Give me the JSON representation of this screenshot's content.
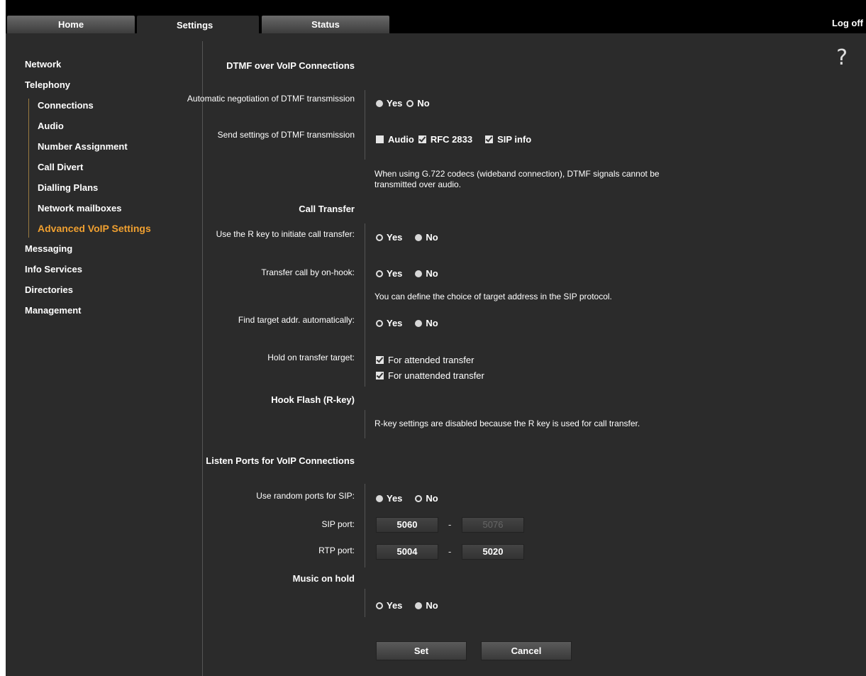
{
  "tabs": [
    {
      "label": "Home"
    },
    {
      "label": "Settings"
    },
    {
      "label": "Status"
    }
  ],
  "logoff": "Log off",
  "help": "?",
  "sidebar": {
    "items": [
      {
        "label": "Network"
      },
      {
        "label": "Telephony"
      },
      {
        "label": "Connections"
      },
      {
        "label": "Audio"
      },
      {
        "label": "Number Assignment"
      },
      {
        "label": "Call Divert"
      },
      {
        "label": "Dialling Plans"
      },
      {
        "label": "Network mailboxes"
      },
      {
        "label": "Advanced VoIP Settings"
      },
      {
        "label": "Messaging"
      },
      {
        "label": "Info Services"
      },
      {
        "label": "Directories"
      },
      {
        "label": "Management"
      }
    ],
    "active_color": "#f0a030"
  },
  "dtmf": {
    "header": "DTMF over VoIP Connections",
    "auto_neg_label": "Automatic negotiation of DTMF transmission",
    "send_settings_label": "Send settings of DTMF transmission",
    "opt_audio": "Audio",
    "opt_rfc": "RFC 2833",
    "opt_sip": "SIP info",
    "note": "When using G.722 codecs (wideband connection), DTMF signals cannot be transmitted over audio."
  },
  "transfer": {
    "header": "Call Transfer",
    "r_key_label": "Use the R key to initiate call transfer:",
    "on_hook_label": "Transfer call by on-hook:",
    "note": "You can define the choice of target address in the SIP protocol.",
    "find_target_label": "Find target addr. automatically:",
    "hold_label": "Hold on transfer target:",
    "attended": "For attended transfer",
    "unattended": "For unattended transfer"
  },
  "hookflash": {
    "header": "Hook Flash (R-key)",
    "note": "R-key settings are disabled because the R key is used for call transfer."
  },
  "ports": {
    "header": "Listen Ports for VoIP Connections",
    "random_label": "Use random ports for SIP:",
    "sip_label": "SIP port:",
    "sip_from": "5060",
    "sip_to": "5076",
    "rtp_label": "RTP port:",
    "rtp_from": "5004",
    "rtp_to": "5020",
    "dash": "-"
  },
  "moh": {
    "header": "Music on hold"
  },
  "yes": "Yes",
  "no": "No",
  "buttons": {
    "set": "Set",
    "cancel": "Cancel"
  }
}
